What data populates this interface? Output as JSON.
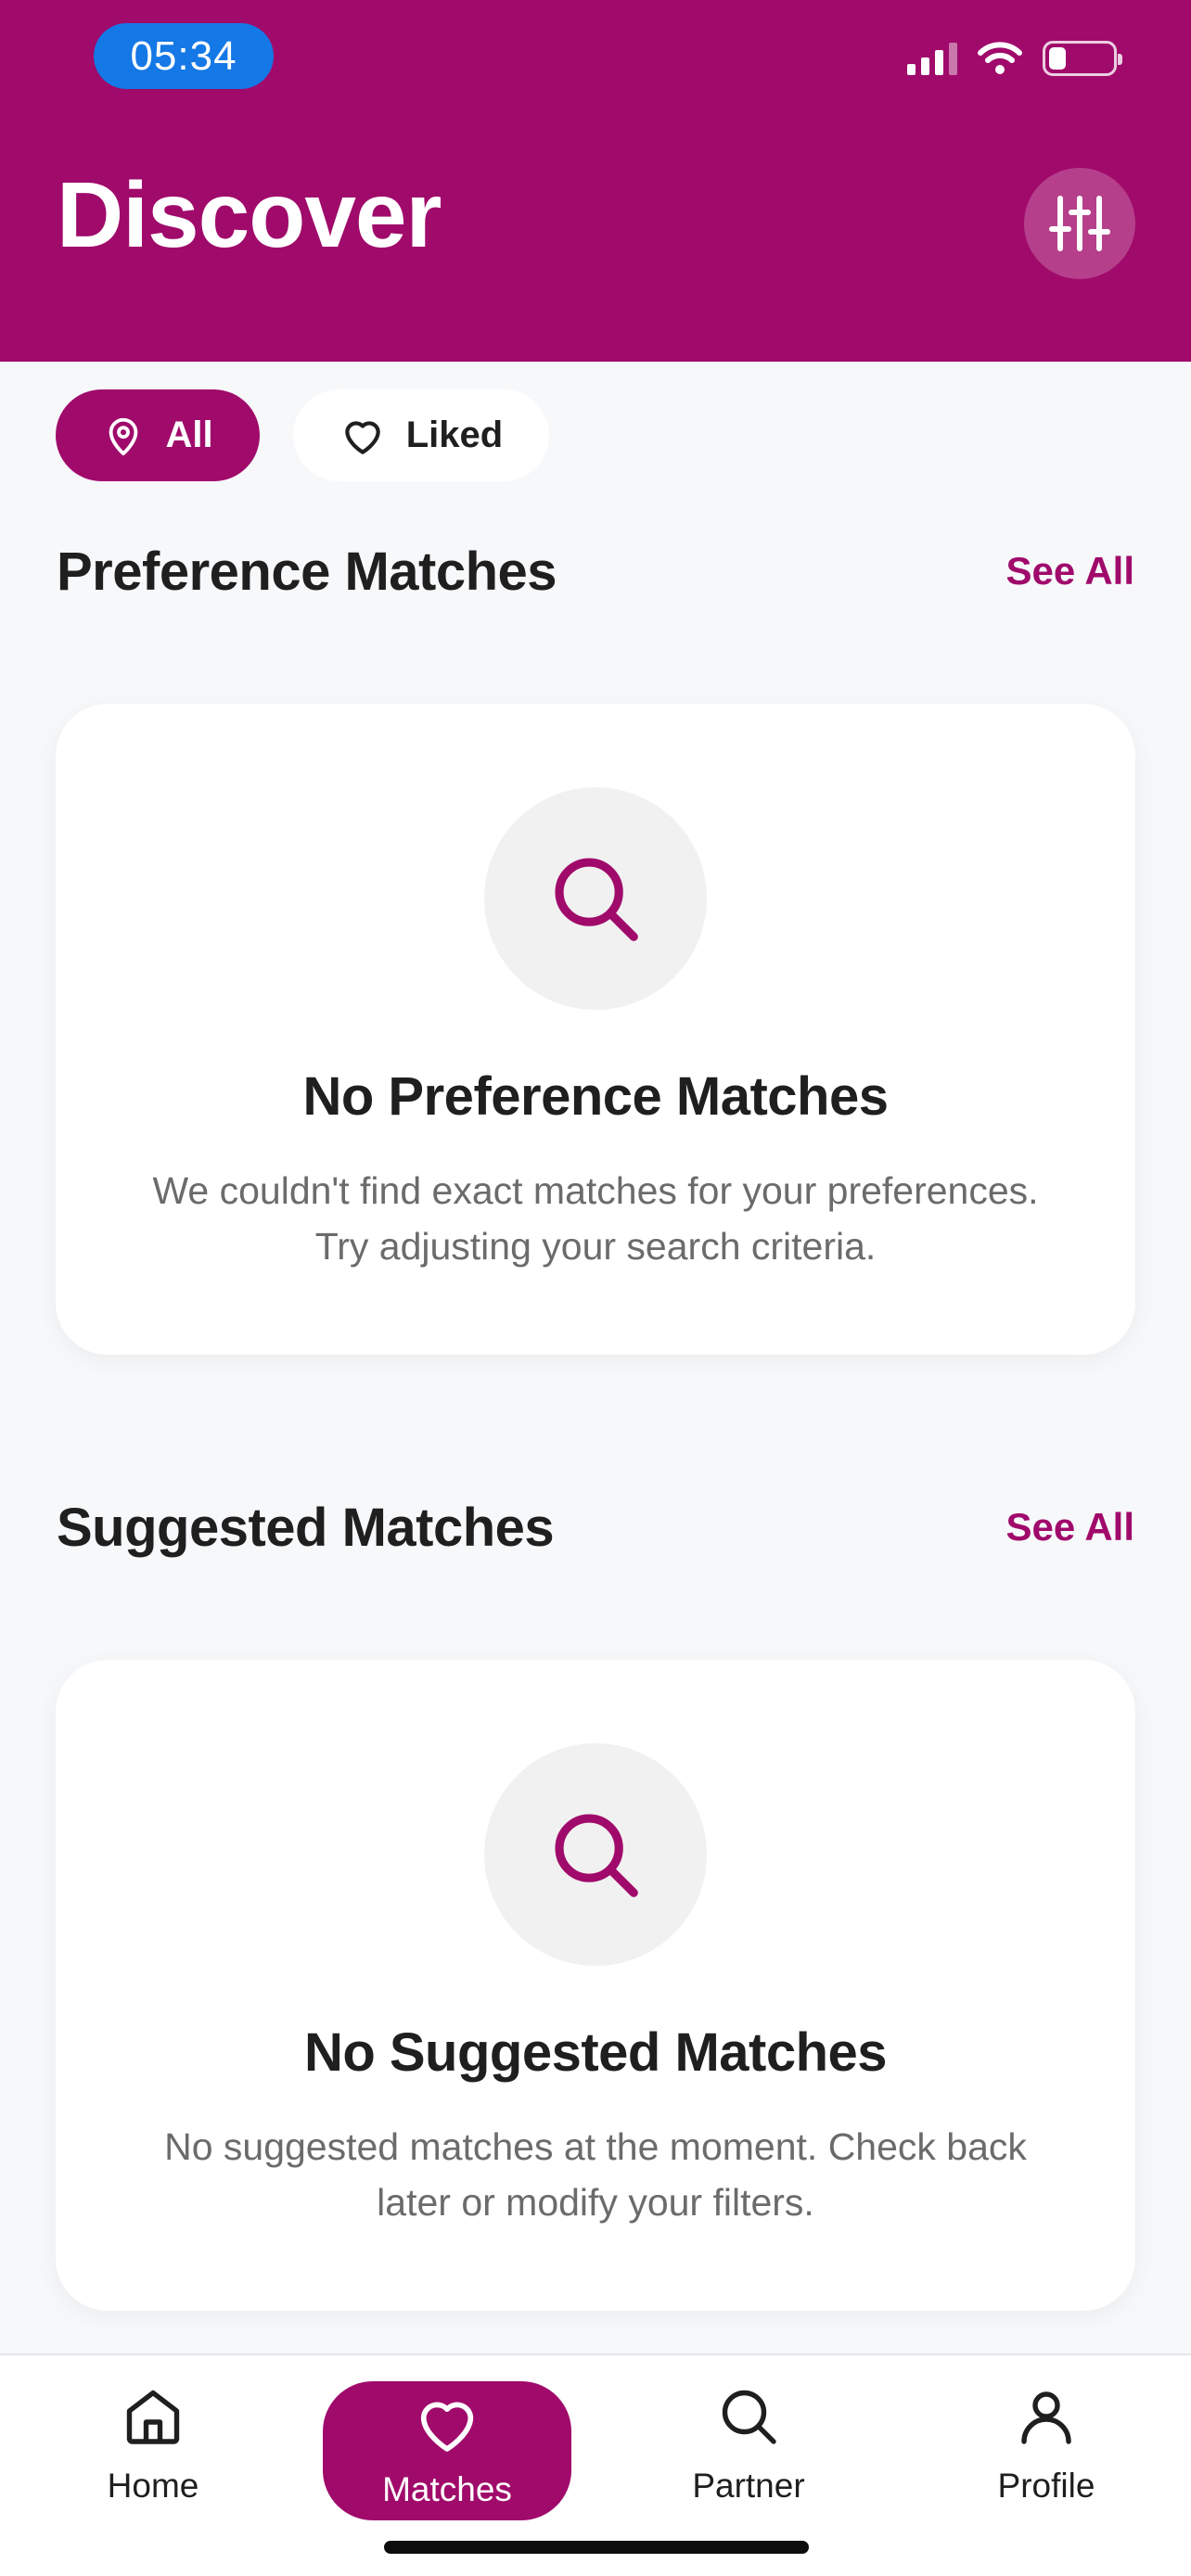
{
  "status_bar": {
    "time": "05:34",
    "icons": [
      "cellular-signal-icon",
      "wifi-icon",
      "battery-icon"
    ],
    "battery_level_fraction": 0.2
  },
  "header": {
    "title": "Discover",
    "filter_icon": "sliders-icon"
  },
  "filters": {
    "all_label": "All",
    "all_icon": "map-pin-icon",
    "liked_label": "Liked",
    "liked_icon": "heart-icon",
    "selected": "All"
  },
  "preference_section": {
    "title": "Preference Matches",
    "see_all": "See All",
    "empty_icon": "search-icon",
    "empty_title": "No Preference Matches",
    "empty_description": "We couldn't find exact matches for your preferences. Try adjusting your search criteria."
  },
  "suggested_section": {
    "title": "Suggested Matches",
    "see_all": "See All",
    "empty_icon": "search-icon",
    "empty_title": "No Suggested Matches",
    "empty_description": "No suggested matches at the moment. Check back later or modify your filters."
  },
  "bottom_nav": {
    "items": [
      {
        "label": "Home",
        "icon": "home-icon"
      },
      {
        "label": "Matches",
        "icon": "heart-icon",
        "active": true
      },
      {
        "label": "Partner",
        "icon": "search-icon"
      },
      {
        "label": "Profile",
        "icon": "user-icon"
      }
    ]
  },
  "colors": {
    "brand": "#a00a6b",
    "background": "#f7f8fa",
    "time_pill": "#1478e6"
  }
}
